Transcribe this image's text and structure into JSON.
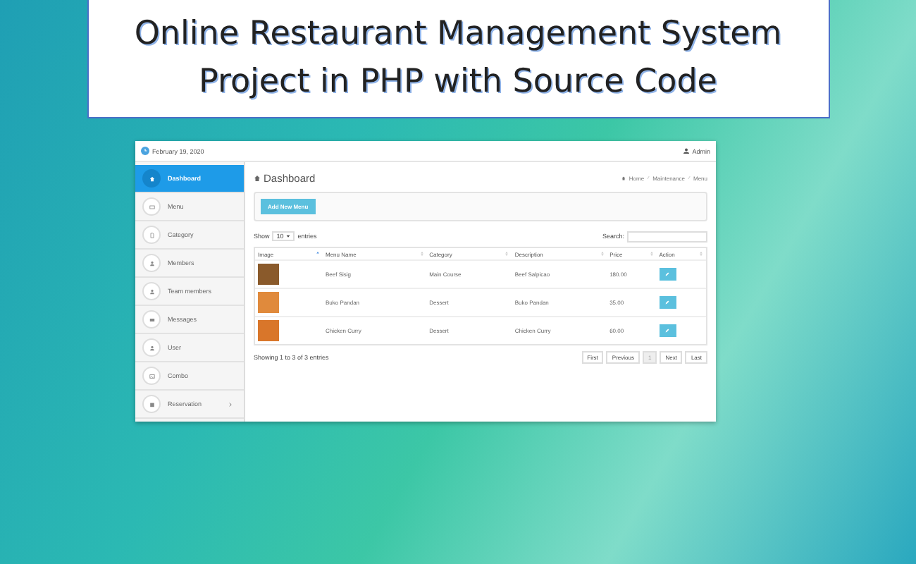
{
  "title_banner": {
    "lines": [
      "Online Restaurant Management System",
      "Project in PHP with Source Code"
    ]
  },
  "app": {
    "top_bar": {
      "date": "February 19, 2020",
      "user": "Admin"
    },
    "sidebar": {
      "items": [
        {
          "label": "Dashboard",
          "selected": true,
          "has_submenu": false
        },
        {
          "label": "Menu",
          "selected": false,
          "has_submenu": false
        },
        {
          "label": "Category",
          "selected": false,
          "has_submenu": false
        },
        {
          "label": "Members",
          "selected": false,
          "has_submenu": false
        },
        {
          "label": "Team members",
          "selected": false,
          "has_submenu": false
        },
        {
          "label": "Messages",
          "selected": false,
          "has_submenu": false
        },
        {
          "label": "User",
          "selected": false,
          "has_submenu": false
        },
        {
          "label": "Combo",
          "selected": false,
          "has_submenu": false
        },
        {
          "label": "Reservation",
          "selected": false,
          "has_submenu": true
        }
      ]
    },
    "page_title": "Dashboard",
    "breadcrumb": [
      "Home",
      "Maintenance",
      "Menu"
    ],
    "add_button": "Add New Menu",
    "length_menu": {
      "prefix": "Show",
      "value": "10",
      "suffix": "entries"
    },
    "search": {
      "label": "Search:"
    },
    "table": {
      "columns": [
        {
          "label": "Image",
          "sorted": true
        },
        {
          "label": "Menu Name",
          "sorted": false
        },
        {
          "label": "Category",
          "sorted": false
        },
        {
          "label": "Description",
          "sorted": false
        },
        {
          "label": "Price",
          "sorted": false
        },
        {
          "label": "Action",
          "sorted": false
        }
      ],
      "rows": [
        {
          "name": "Beef Sisig",
          "category": "Main Course",
          "description": "Beef Salpicao",
          "price": "180.00"
        },
        {
          "name": "Buko Pandan",
          "category": "Dessert",
          "description": "Buko Pandan",
          "price": "35.00"
        },
        {
          "name": "Chicken Curry",
          "category": "Dessert",
          "description": "Chicken Curry",
          "price": "60.00"
        }
      ]
    },
    "info": "Showing 1 to 3 of 3 entries",
    "pagination": [
      {
        "label": "First",
        "selected": false
      },
      {
        "label": "Previous",
        "selected": false
      },
      {
        "label": "1",
        "selected": true
      },
      {
        "label": "Next",
        "selected": false
      },
      {
        "label": "Last",
        "selected": false
      }
    ]
  }
}
